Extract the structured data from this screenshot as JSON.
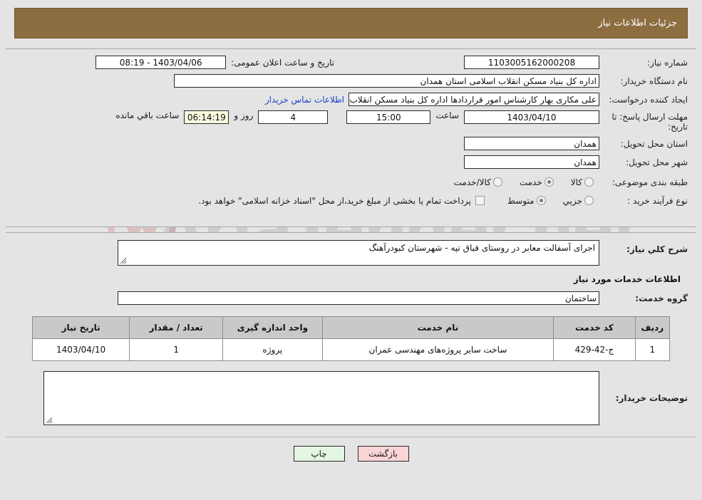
{
  "header": {
    "title": "جزئیات اطلاعات نیاز"
  },
  "watermark": {
    "text": "AriaTender.net"
  },
  "summary": {
    "need_number_label": "شماره نیاز:",
    "need_number_value": "1103005162000208",
    "announce_label": "تاریخ و ساعت اعلان عمومی:",
    "announce_value": "1403/04/06 - 08:19",
    "buyer_org_label": "نام دستگاه خریدار:",
    "buyer_org_value": "اداره کل بنیاد مسکن انقلاب اسلامی استان همدان",
    "creator_label": "ایجاد کننده درخواست:",
    "creator_value": "علی مکاری بهار کارشناس امور قراردادها اداره کل بنیاد مسکن انقلاب اسلامی ا",
    "contact_link": "اطلاعات تماس خریدار",
    "deadline_label": "مهلت ارسال پاسخ: تا تاریخ:",
    "deadline_date": "1403/04/10",
    "deadline_time_label": "ساعت",
    "deadline_time": "15:00",
    "remaining_days": "4",
    "remaining_days_label": "روز و",
    "remaining_clock": "06:14:19",
    "remaining_clock_label": "ساعت باقي مانده",
    "province_label": "استان محل تحویل:",
    "province_value": "همدان",
    "city_label": "شهر محل تحویل:",
    "city_value": "همدان",
    "category_label": "طبقه بندی موضوعی:",
    "category_options": [
      {
        "label": "کالا",
        "selected": false
      },
      {
        "label": "خدمت",
        "selected": true
      },
      {
        "label": "کالا/خدمت",
        "selected": false
      }
    ],
    "process_label": "نوع فرآیند خرید :",
    "process_options": [
      {
        "label": "جزیي",
        "selected": false
      },
      {
        "label": "متوسط",
        "selected": true
      }
    ],
    "treasury_checkbox_label": "پرداخت تمام یا بخشی از مبلغ خرید،از محل \"اسناد خزانه اسلامی\" خواهد بود.",
    "treasury_checked": false
  },
  "description": {
    "label": "شرح کلي نیاز:",
    "value": "اجرای آسفالت معابر در روستای قباق تپه - شهرستان کبودرآهنگ"
  },
  "services": {
    "section_title": "اطلاعات خدمات مورد نیاز",
    "group_label": "گروه خدمت:",
    "group_value": "ساختمان",
    "table": {
      "columns": [
        "ردیف",
        "کد خدمت",
        "نام خدمت",
        "واحد اندازه گیری",
        "تعداد / مقدار",
        "تاریخ نیاز"
      ],
      "rows": [
        {
          "row_no": "1",
          "code": "ج-42-429",
          "name": "ساخت سایر پروژه‌های مهندسی عمران",
          "unit": "پروژه",
          "quantity": "1",
          "need_date": "1403/04/10"
        }
      ]
    }
  },
  "buyer_notes": {
    "label": "توضیحات خریدار:",
    "value": ""
  },
  "footer": {
    "print_label": "چاپ",
    "back_label": "بازگشت"
  },
  "colors": {
    "header_brown": "#8d6e41",
    "page_background": "#e4e4e4",
    "link_blue": "#1b3fd0",
    "back_button": "#fbd5d5",
    "print_button": "#e3f6e3",
    "countdown_field": "#fbfbe0",
    "table_header": "#c9c9c9"
  }
}
